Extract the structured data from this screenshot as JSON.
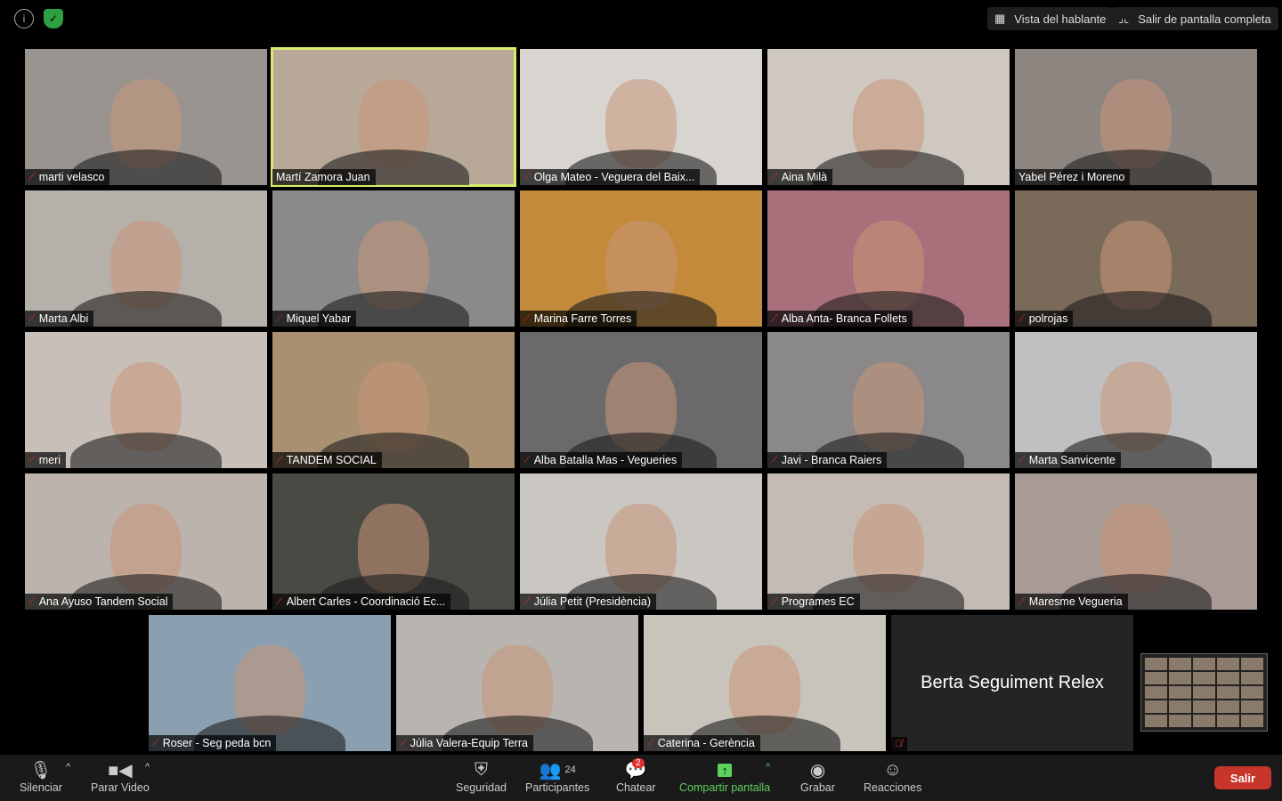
{
  "top": {
    "info_icon": "info-icon",
    "security_icon": "shield-check-icon",
    "speaker_view": "Vista del hablante",
    "exit_fullscreen": "Salir de pantalla completa"
  },
  "colors": {
    "active_speaker": "#d8ec6b",
    "leave": "#c8352a",
    "share": "#5dd25d",
    "muted": "#e0302e"
  },
  "participants": [
    {
      "name": "marti velasco",
      "muted": true,
      "bg": "#9a9490"
    },
    {
      "name": "Martí Zamora Juan",
      "muted": false,
      "active": true,
      "bg": "#b8a898"
    },
    {
      "name": "Olga Mateo - Veguera del Baix...",
      "muted": true,
      "bg": "#d8d4d0"
    },
    {
      "name": "Aina Milà",
      "muted": true,
      "bg": "#cfc8c0"
    },
    {
      "name": "Yabel Pérez i Moreno",
      "muted": false,
      "bg": "#8c8580"
    },
    {
      "name": "Marta Albi",
      "muted": true,
      "bg": "#b6b0aa"
    },
    {
      "name": "Miquel Yabar",
      "muted": true,
      "bg": "#8a8a8a"
    },
    {
      "name": "Marina Farre Torres",
      "muted": true,
      "bg": "#c28a3a"
    },
    {
      "name": "Alba Anta- Branca Follets",
      "muted": true,
      "bg": "#a8707a"
    },
    {
      "name": "polrojas",
      "muted": true,
      "bg": "#7a6a5a"
    },
    {
      "name": "meri",
      "muted": true,
      "bg": "#c8c0b8"
    },
    {
      "name": "TANDEM SOCIAL",
      "muted": true,
      "bg": "#a89070"
    },
    {
      "name": "Alba Batalla Mas - Vegueries",
      "muted": true,
      "bg": "#6a6a6a"
    },
    {
      "name": "Javi - Branca Raiers",
      "muted": true,
      "bg": "#8a8888"
    },
    {
      "name": "Marta Sanvicente",
      "muted": true,
      "bg": "#c0c0c2"
    },
    {
      "name": "Ana Ayuso Tandem Social",
      "muted": true,
      "bg": "#bcb4ac"
    },
    {
      "name": "Albert Carles - Coordinació Ec...",
      "muted": true,
      "bg": "#4a4a44"
    },
    {
      "name": "Júlia Petit (Presidència)",
      "muted": true,
      "bg": "#cac6c2"
    },
    {
      "name": "Programes EC",
      "muted": true,
      "bg": "#c4bcb4"
    },
    {
      "name": "Maresme Vegueria",
      "muted": true,
      "bg": "#a89a94"
    },
    {
      "name": "Roser - Seg peda bcn",
      "muted": true,
      "bg": "#8aa0b0"
    },
    {
      "name": "Júlia Valera-Equip Terra",
      "muted": true,
      "bg": "#b8b4b0"
    },
    {
      "name": "Caterina - Gerència",
      "muted": true,
      "bg": "#c8c4bc"
    },
    {
      "name": "Berta Seguiment Relex",
      "muted": true,
      "video_off": true,
      "bg": "#242424"
    }
  ],
  "toolbar": {
    "mute": "Silenciar",
    "stop_video": "Parar Video",
    "security": "Seguridad",
    "participants": "Participantes",
    "participants_count": "24",
    "chat": "Chatear",
    "chat_badge": "2",
    "share": "Compartir pantalla",
    "record": "Grabar",
    "reactions": "Reacciones",
    "leave": "Salir"
  }
}
